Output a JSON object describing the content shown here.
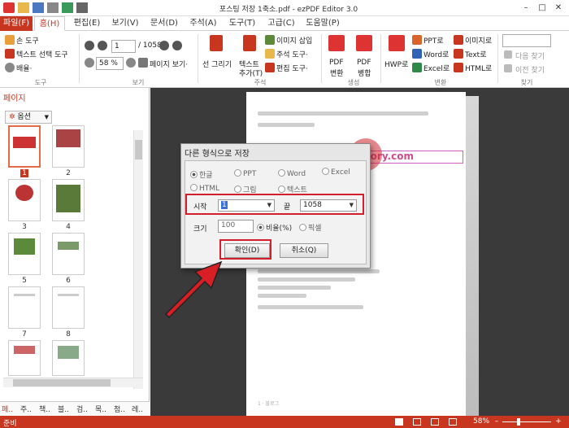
{
  "app": {
    "title": "포스팅 저장 1축소.pdf - ezPDF Editor 3.0",
    "win_min": "–",
    "win_max": "□",
    "win_close": "✕"
  },
  "tabs": [
    "파일(F)",
    "홈(H)",
    "편집(E)",
    "보기(V)",
    "문서(D)",
    "주석(A)",
    "도구(T)",
    "고급(C)",
    "도움말(P)"
  ],
  "ribbon": {
    "tools": {
      "hand": "손 도구",
      "text_select": "텍스트 선택 도구",
      "zoom": "배율·",
      "label": "도구"
    },
    "view": {
      "page_value": "1",
      "page_total": "/ 1058",
      "zoom_value": "58 %",
      "page_view": "페이지 보기·",
      "label": "보기"
    },
    "annot": {
      "line_draw": "선 그리기",
      "text_add_1": "텍스트",
      "text_add_2": "추가(T)",
      "image_insert": "이미지 삽입",
      "annot_tool": "주석 도구·",
      "edit_tool": "편집 도구·",
      "label": "주석"
    },
    "convert_group": {
      "pdf_convert_1": "PDF",
      "pdf_convert_2": "변환",
      "pdf_merge_1": "PDF",
      "pdf_merge_2": "병합",
      "label": "생성"
    },
    "convert": {
      "hwp": "HWP로",
      "ppt": "PPT로",
      "word": "Word로",
      "excel": "Excel로",
      "image": "이미지로",
      "text": "Text로",
      "html": "HTML로",
      "label": "변환"
    },
    "find": {
      "next": "다음 찾기",
      "prev": "이전 찾기",
      "label": "찾기"
    }
  },
  "left_panel": {
    "title": "페이지",
    "options": "옵션",
    "page_numbers": [
      "1",
      "2",
      "3",
      "4",
      "5",
      "6",
      "7",
      "8"
    ],
    "tabs": [
      "페..",
      "주..",
      "책..",
      "블..",
      "검..",
      "목..",
      "첨..",
      "레.."
    ]
  },
  "document": {
    "footer": "1 · 블로그"
  },
  "dialog": {
    "title": "다른 형식으로 저장",
    "formats": [
      "한글",
      "PPT",
      "Word",
      "Excel",
      "HTML",
      "그림",
      "텍스트"
    ],
    "start_label": "시작",
    "start_value": "1",
    "end_label": "끝",
    "end_value": "1058",
    "size_label": "크기",
    "size_value": "100",
    "ratio": "비율(%)",
    "pixel": "픽셀",
    "ok": "확인(D)",
    "cancel": "취소(Q)",
    "watermark": "havestory.tistory.com"
  },
  "statusbar": {
    "status": "준비",
    "zoom": "58%"
  },
  "colors": {
    "accent": "#c8361f",
    "highlight": "#d21f2b"
  }
}
